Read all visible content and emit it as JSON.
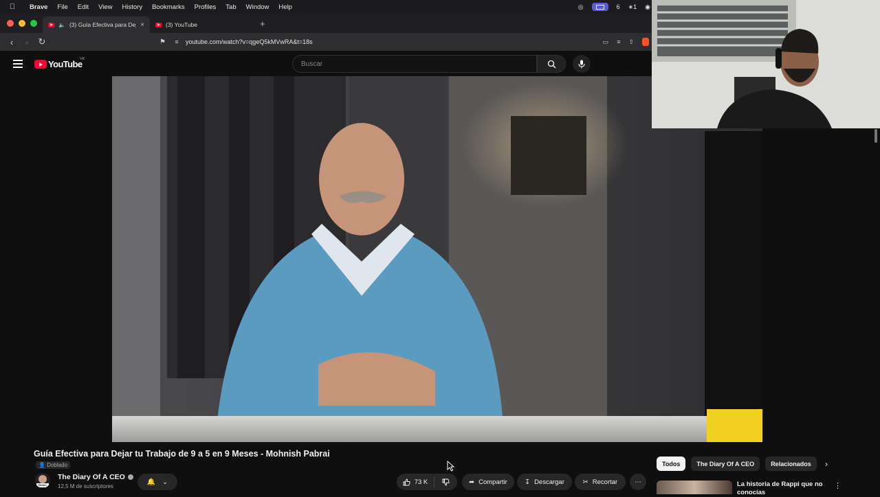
{
  "menubar": {
    "app": "Brave",
    "items": [
      "File",
      "Edit",
      "View",
      "History",
      "Bookmarks",
      "Profiles",
      "Tab",
      "Window",
      "Help"
    ],
    "status_count": "6",
    "status_extra": "∗1"
  },
  "tabs": [
    {
      "title": "(3) Guía Efectiva para Dejar tu Trabajo",
      "active": true
    },
    {
      "title": "(3) YouTube",
      "active": false
    }
  ],
  "address": {
    "url": "youtube.com/watch?v=qgeQ5kMVwRA&t=18s"
  },
  "youtube": {
    "logo_text": "YouTube",
    "country_code": "VE",
    "search_placeholder": "Buscar"
  },
  "video": {
    "title": "Guía Efectiva para Dejar tu Trabajo de 9 a 5 en 9 Meses - Mohnish Pabrai",
    "dub_badge": "Doblado",
    "channel_name": "The Diary Of A CEO",
    "avatar_label": "DOAC",
    "subscribers": "12,5 M de suscriptores",
    "likes": "73 K",
    "share_label": "Compartir",
    "download_label": "Descargar",
    "clip_label": "Recortar"
  },
  "chips": [
    "Todos",
    "The Diary Of A CEO",
    "Relacionados"
  ],
  "recommendation": {
    "title": "La historia de Rappi que no conocías"
  },
  "colors": {
    "background": "#0f0f0f",
    "youtube_red": "#ff0033",
    "chip_bg": "#272727"
  }
}
